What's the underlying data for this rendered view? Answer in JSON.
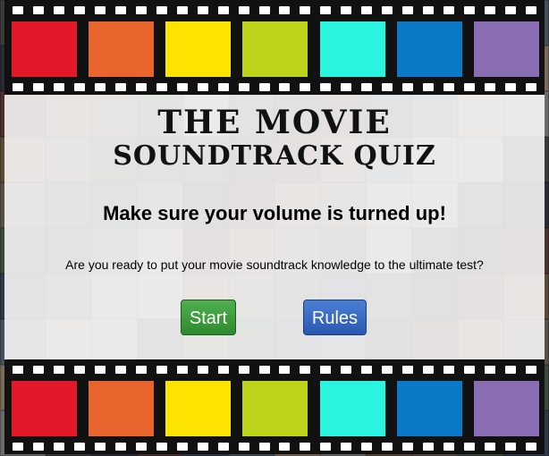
{
  "title": {
    "line1": "THE MOVIE",
    "line2": "SOUNDTRACK QUIZ"
  },
  "heading": "Make sure your volume is turned up!",
  "prompt": "Are you ready to put your movie soundtrack knowledge to the ultimate test?",
  "buttons": {
    "start_label": "Start",
    "rules_label": "Rules"
  },
  "colors": {
    "swatches": [
      "#e3192a",
      "#e8662d",
      "#fde400",
      "#bdd41a",
      "#28f4e0",
      "#0b79c8",
      "#8a6eb4"
    ],
    "start_button": "#3a9a3a",
    "rules_button": "#3566c4"
  }
}
